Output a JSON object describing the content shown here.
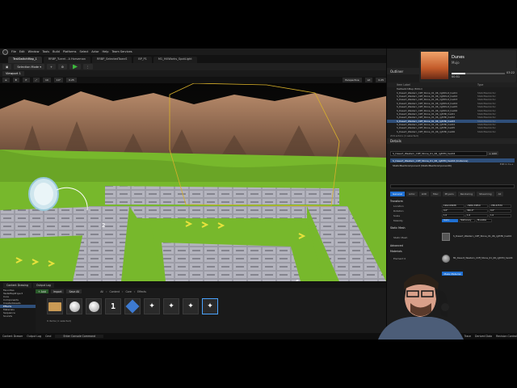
{
  "menubar": {
    "items": [
      "File",
      "Edit",
      "Window",
      "Tools",
      "Build",
      "Platforms",
      "Select",
      "Actor",
      "Help",
      "Team Services"
    ]
  },
  "tabs": [
    {
      "label": "TestSwitchMap_1"
    },
    {
      "label": "RRBP_Turret - A Horseman"
    },
    {
      "label": "RRBP_SelectedTownS"
    },
    {
      "label": "BP_P1"
    },
    {
      "label": "M1_HillWorks_SpotLight"
    }
  ],
  "toolbar": {
    "mode_label": "Selection Mode"
  },
  "viewport": {
    "tab_label": "Viewport 1",
    "perspective_label": "Perspective",
    "lit_label": "Lit",
    "scale_label": "0.25",
    "grid_values": [
      "10",
      "10°",
      "0.25"
    ],
    "tile_numbers": [
      "2",
      "6",
      "12"
    ]
  },
  "music": {
    "title": "Dunes",
    "artist": "Mujo",
    "time_elapsed": "00:51",
    "time_total": "03:22",
    "progress": 0.25
  },
  "outliner": {
    "title": "Outliner",
    "columns": {
      "label": "Item Label",
      "type": "Type"
    },
    "rows": [
      {
        "label": "TestSwitchMap (Editor)",
        "type": ""
      },
      {
        "label": "S_Desert_Western_Cliff_Stone_01_06_rightfoot_hex01",
        "type": "StaticMeshActor"
      },
      {
        "label": "S_Desert_Western_Cliff_Stone_01_06_rightfoot_hex02",
        "type": "StaticMeshActor"
      },
      {
        "label": "S_Desert_Western_Cliff_Stone_01_06_rightfoot_hex03",
        "type": "StaticMeshActor"
      },
      {
        "label": "S_Desert_Western_Cliff_Stone_01_06_rightfoot_hex04",
        "type": "StaticMeshActor"
      },
      {
        "label": "S_Desert_Western_Cliff_Stone_01_06_rightfoot_hex05",
        "type": "StaticMeshActor"
      },
      {
        "label": "S_Desert_Western_Cliff_Stone_01_06_rightfoot_hex06",
        "type": "StaticMeshActor"
      },
      {
        "label": "S_Desert_Western_Cliff_Stone_01_06_rgthfill_hex01",
        "type": "StaticMeshActor"
      },
      {
        "label": "S_Desert_Western_Cliff_Stone_01_06_rgthfill_hex02",
        "type": "StaticMeshActor"
      },
      {
        "label": "S_Desert_Western_Cliff_Stone_01_06_rgthfill_hex03",
        "type": "StaticMeshActor"
      },
      {
        "label": "S_Desert_Western_Cliff_Stone_01_06_rgthfill_hex04",
        "type": "StaticMeshActor"
      },
      {
        "label": "S_Desert_Western_Cliff_Stone_01_06_rgthfill_hex05",
        "type": "StaticMeshActor"
      },
      {
        "label": "S_Desert_Western_Cliff_Stone_01_06_rgthfill_hex06",
        "type": "StaticMeshActor"
      }
    ],
    "count_label": "216 actors (1 selected)"
  },
  "details": {
    "title": "Details",
    "object_name": "S_Desert_Western_Cliff_Stone_01_06_rgthfill_hex04",
    "component_root": "S_Desert_Western_Cliff_Stone_01_06_rgthfill_hex04 (Instance)",
    "component_child": "StaticMeshComponent (StaticMeshComponent0)",
    "add_label": "+ Add",
    "edit_in_label": "Edit in C++",
    "categories": [
      "General",
      "Actor",
      "LOD",
      "Misc",
      "Physics",
      "Rendering",
      "Streaming",
      "All"
    ],
    "transform": {
      "section": "Transform",
      "location_label": "Location",
      "location": [
        "1962.08938",
        "-3980.33859",
        "-788.67570"
      ],
      "rotation_label": "Rotation",
      "rotation": [
        "0.0°",
        "360.0°",
        "0.0°"
      ],
      "scale_label": "Scale",
      "scale": [
        "1.0",
        "1.0",
        "1.0"
      ],
      "mobility_label": "Mobility",
      "mobility_options": [
        "Static",
        "Stationary",
        "Movable"
      ]
    },
    "static_mesh": {
      "section": "Static Mesh",
      "label": "Static Mesh",
      "value": "S_Desert_Western_Cliff_Stone_01_06_rgthfill_hex04"
    },
    "advanced_label": "Advanced",
    "materials": {
      "section": "Materials",
      "element_label": "Element 0",
      "value": "MI_Desert_Western_Cliff_Stone_01_06_rgthfill_hex04"
    },
    "browse_button": "Make Material"
  },
  "content_drawer": {
    "tabs": [
      "Content Drawing",
      "Output Log",
      "Cmd"
    ],
    "add_label": "+ Add",
    "import_label": "Import",
    "save_all_label": "Save All",
    "breadcrumbs": [
      "All",
      "Content",
      "Core",
      "Effects"
    ],
    "tree": [
      {
        "label": "Favorites",
        "selected": false
      },
      {
        "label": "TestsMapProject",
        "selected": false
      },
      {
        "label": "Core",
        "selected": false
      },
      {
        "label": "Components",
        "selected": false
      },
      {
        "label": "CreatedAssets",
        "selected": false
      },
      {
        "label": "Effects",
        "selected": true
      },
      {
        "label": "Materials",
        "selected": false
      },
      {
        "label": "Sequence",
        "selected": false
      },
      {
        "label": "Sounds",
        "selected": false
      }
    ],
    "collections_label": "Collections",
    "status_label": "9 items (1 selected)",
    "asset_digit": "1"
  },
  "statusbar": {
    "items": [
      "Content Drawer",
      "Output Log",
      "Cmd",
      "Enter Console Command",
      "Trace",
      "Derived Data",
      "Revision Control"
    ]
  },
  "colors": {
    "selection": "#2f4f7a",
    "accent_blue": "#1f6fd1",
    "play_green": "#3dbb3d"
  }
}
